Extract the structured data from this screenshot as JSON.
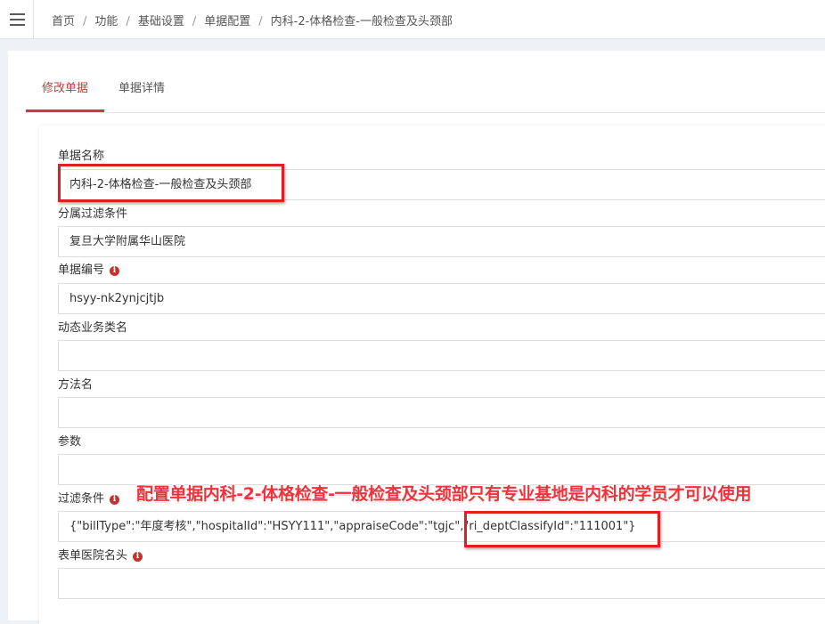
{
  "breadcrumb": {
    "items": [
      "首页",
      "功能",
      "基础设置",
      "单据配置",
      "内科-2-体格检查-一般检查及头颈部"
    ],
    "separator": "/"
  },
  "tabs": [
    {
      "label": "修改单据",
      "active": true
    },
    {
      "label": "单据详情",
      "active": false
    }
  ],
  "form": {
    "bill_name": {
      "label": "单据名称",
      "value": "内科-2-体格检查-一般检查及头颈部"
    },
    "filter_affiliation": {
      "label": "分属过滤条件",
      "value": "复旦大学附属华山医院"
    },
    "bill_code": {
      "label": "单据编号",
      "value": "hsyy-nk2ynjcjtjb"
    },
    "dynamic_class": {
      "label": "动态业务类名",
      "value": ""
    },
    "method_name": {
      "label": "方法名",
      "value": ""
    },
    "params": {
      "label": "参数",
      "value": ""
    },
    "filter_condition": {
      "label": "过滤条件",
      "value": "{\"billType\":\"年度考核\",\"hospitalId\":\"HSYY111\",\"appraiseCode\":\"tgjc\",\"ri_deptClassifyId\":\"111001\"}"
    },
    "hospital_header": {
      "label": "表单医院名头",
      "value": ""
    }
  },
  "annotation": {
    "text": "配置单据内科-2-体格检查-一般检查及头颈部只有专业基地是内科的学员才可以使用"
  },
  "icons": {
    "menu": "hamburger-menu-icon",
    "info": "info-circle-icon"
  },
  "colors": {
    "accent": "#c43c3c",
    "highlight_box": "#e01f1f",
    "info_icon": "#c7322e",
    "annotation_text": "#f0323a"
  }
}
